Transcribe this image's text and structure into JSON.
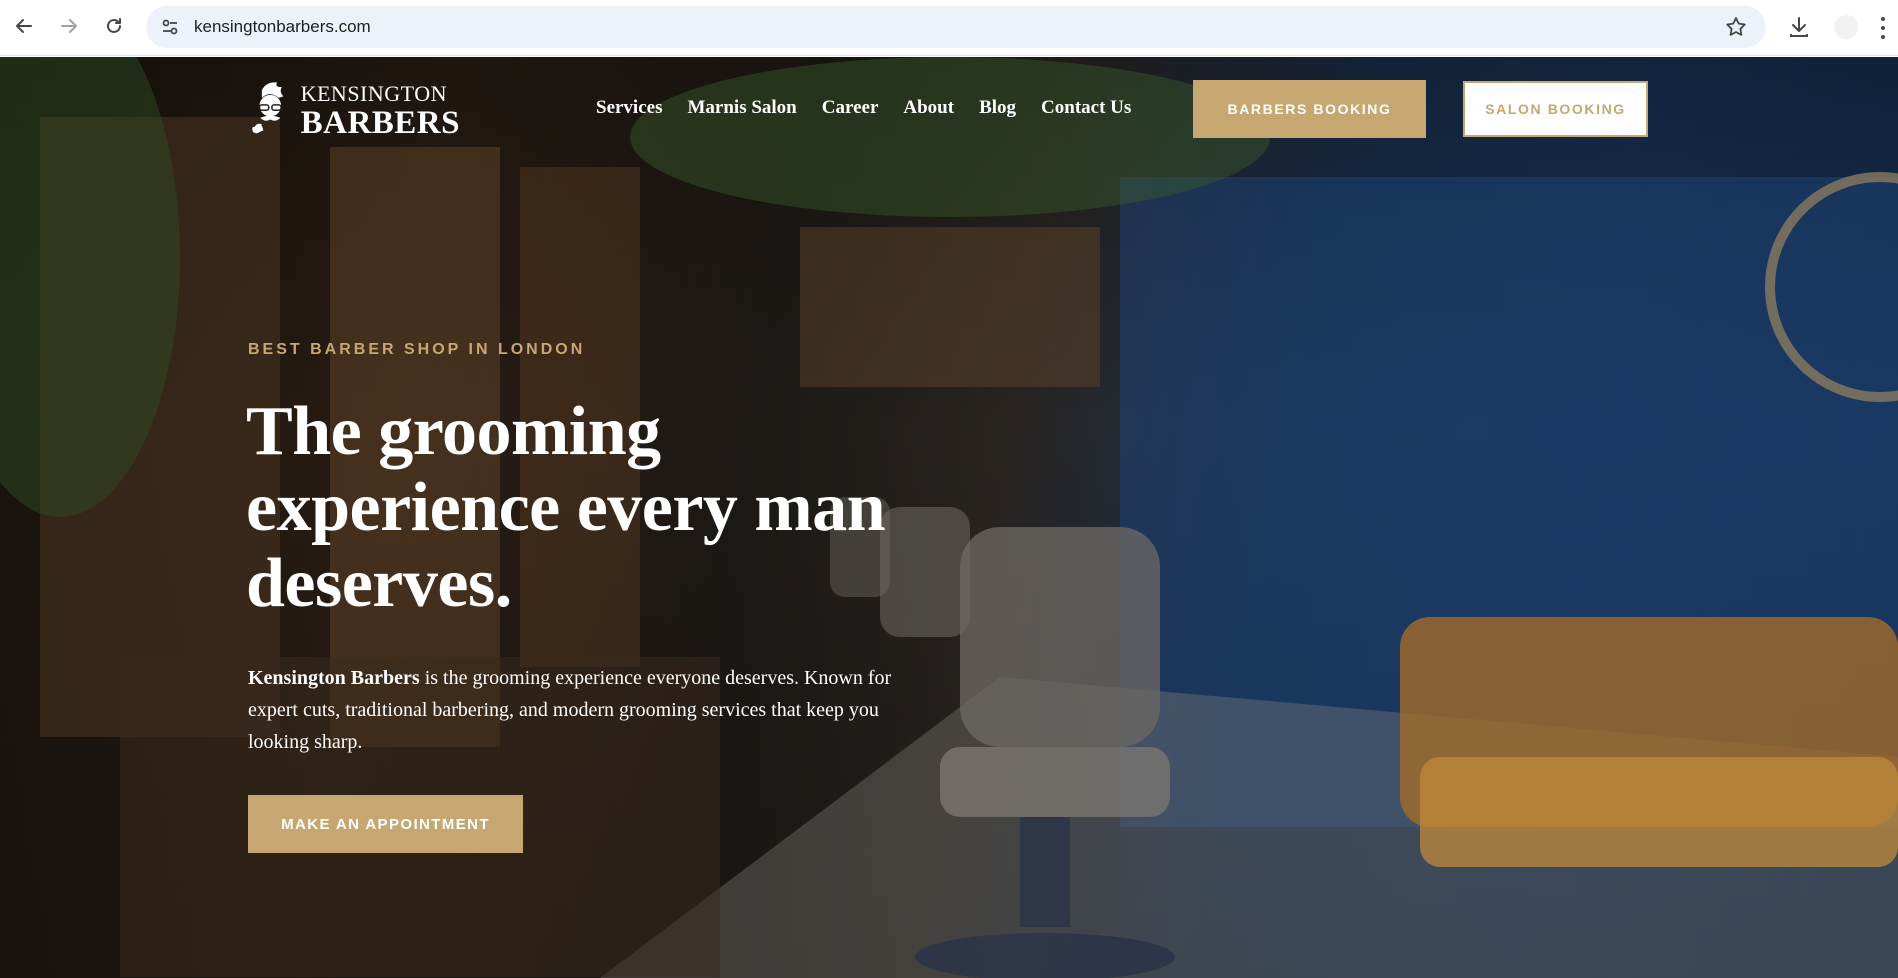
{
  "browser": {
    "url": "kensingtonbarbers.com",
    "icons": [
      "back-arrow-icon",
      "forward-arrow-icon",
      "reload-icon",
      "site-settings-icon",
      "bookmark-star-icon",
      "download-icon",
      "profile-avatar",
      "more-menu-icon"
    ]
  },
  "header": {
    "logo_line1": "KENSINGTON",
    "logo_line2": "BARBERS",
    "nav": [
      "Services",
      "Marnis Salon",
      "Career",
      "About",
      "Blog",
      "Contact Us"
    ],
    "barbers_booking": "BARBERS BOOKING",
    "salon_booking": "SALON BOOKING"
  },
  "hero": {
    "eyebrow": "BEST BARBER SHOP IN LONDON",
    "headline": "The grooming experience every man deserves.",
    "lead_bold": "Kensington Barbers",
    "lead_rest": " is the grooming experience everyone deserves. Known for expert cuts, traditional barbering, and modern grooming services that keep you looking sharp.",
    "cta": "MAKE AN APPOINTMENT"
  },
  "colors": {
    "accent_gold": "#c6a771",
    "text_light": "#ffffff",
    "wall_blue": "#1d3f6e"
  }
}
